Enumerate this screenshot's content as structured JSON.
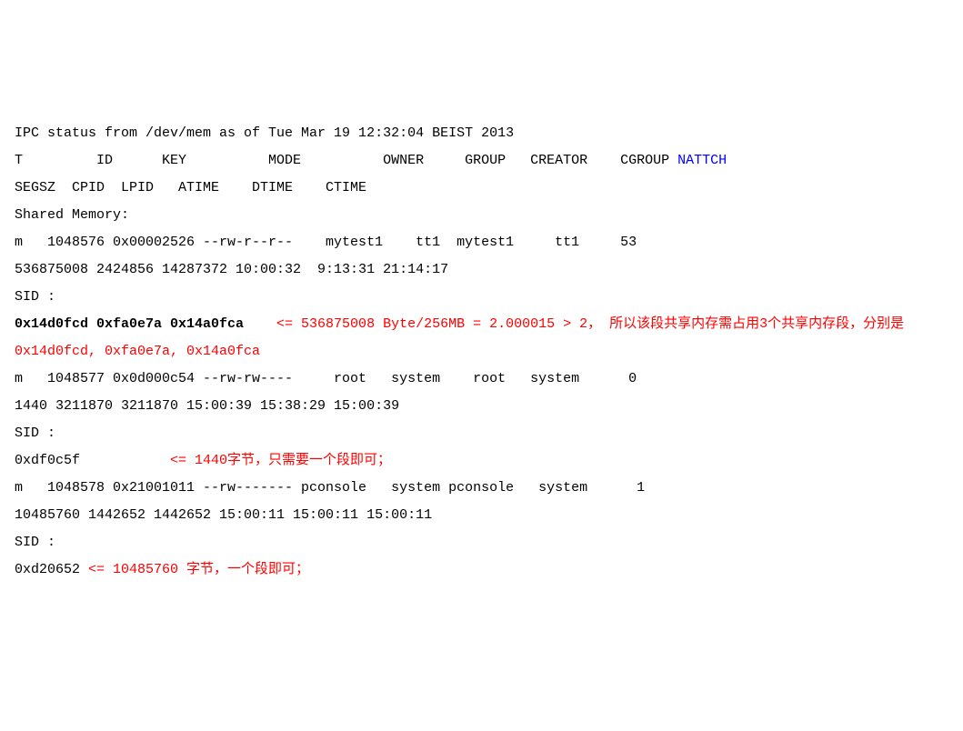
{
  "header_line": "IPC status from /dev/mem as of Tue Mar 19 12:32:04 BEIST 2013",
  "col_header_line1_part1": "T         ID      KEY          MODE          OWNER     GROUP   CREATOR    CGROUP ",
  "col_header_line1_nattch": "NATTCH",
  "col_header_line2": "SEGSZ  CPID  LPID   ATIME    DTIME    CTIME",
  "shared_memory_label": "Shared Memory:",
  "entry1_line1": "m   1048576 0x00002526 --rw-r--r--    mytest1    tt1  mytest1     tt1     53",
  "entry1_line2": "536875008 2424856 14287372 10:00:32  9:13:31 21:14:17",
  "sid_label_1": "SID :",
  "entry1_sids": "0x14d0fcd 0xfa0e7a 0x14a0fca    ",
  "entry1_note_part_a": "<= 536875008 Byte/256MB = 2.000015 > 2， 所以该段共享内存需占用3个共享内存段，分别是0x14d0fcd, 0xfa0e7a, 0x14a0fca",
  "entry2_line1": "m   1048577 0x0d000c54 --rw-rw----     root   system    root   system      0",
  "entry2_line2": "1440 3211870 3211870 15:00:39 15:38:29 15:00:39",
  "sid_label_2": "SID :",
  "entry2_sid": "0xdf0c5f           ",
  "entry2_note": "<= 1440字节，只需要一个段即可；",
  "entry3_line1": "m   1048578 0x21001011 --rw------- pconsole   system pconsole   system      1",
  "entry3_line2": "10485760 1442652 1442652 15:00:11 15:00:11 15:00:11",
  "sid_label_3": "SID :",
  "entry3_sid": "0xd20652 ",
  "entry3_note": "<= 10485760 字节，一个段即可；"
}
